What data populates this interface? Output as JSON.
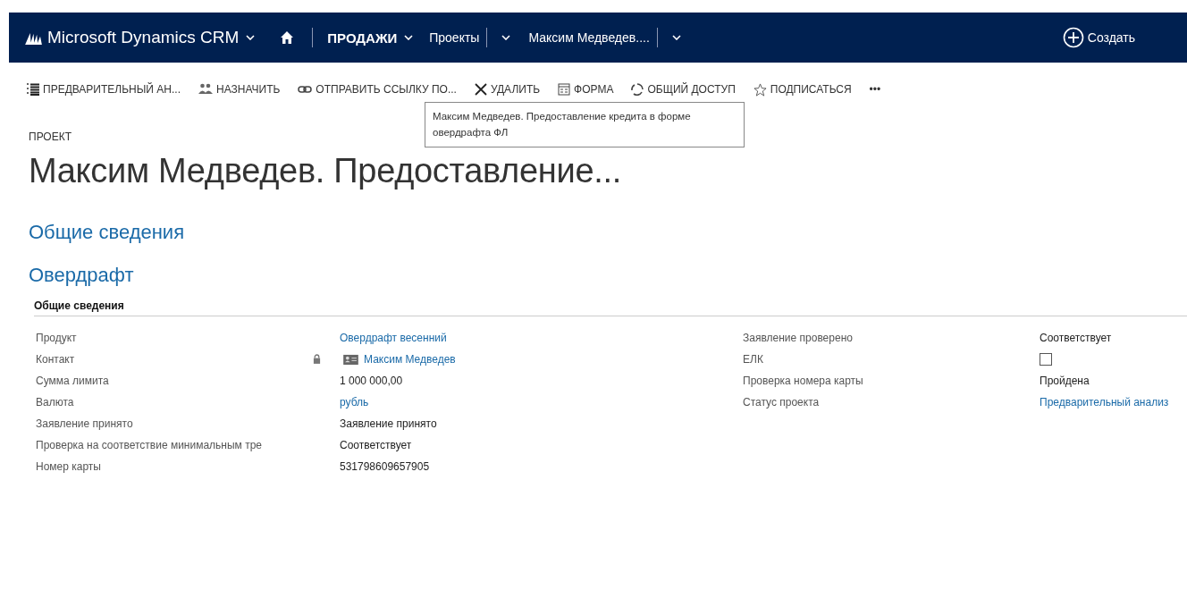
{
  "navbar": {
    "brand": "Microsoft Dynamics CRM",
    "area": "ПРОДАЖИ",
    "entity": "Проекты",
    "record": "Максим Медведев....",
    "create": "Создать"
  },
  "commands": [
    {
      "kind": "list",
      "label": "ПРЕДВАРИТЕЛЬНЫЙ АН..."
    },
    {
      "kind": "people",
      "label": "НАЗНАЧИТЬ"
    },
    {
      "kind": "link",
      "label": "ОТПРАВИТЬ ССЫЛКУ ПО..."
    },
    {
      "kind": "delete",
      "label": "УДАЛИТЬ"
    },
    {
      "kind": "form",
      "label": "ФОРМА"
    },
    {
      "kind": "share",
      "label": "ОБЩИЙ ДОСТУП"
    },
    {
      "kind": "star",
      "label": "ПОДПИСАТЬСЯ"
    },
    {
      "kind": "more",
      "label": "•••"
    }
  ],
  "tooltip": "Максим Медведев. Предоставление кредита в форме овердрафта ФЛ",
  "entity_label": "ПРОЕКТ",
  "title": "Максим Медведев. Предоставление...",
  "tabs": [
    "Общие сведения",
    "Овердрафт"
  ],
  "section": {
    "title": "Общие сведения",
    "left_fields": [
      {
        "label": "Продукт",
        "kind": "link",
        "value": "Овердрафт весенний",
        "locked": false
      },
      {
        "label": "Контакт",
        "kind": "contact",
        "value": "Максим Медведев",
        "locked": true
      },
      {
        "label": "Сумма лимита",
        "kind": "text",
        "value": "1 000 000,00",
        "locked": false
      },
      {
        "label": "Валюта",
        "kind": "link",
        "value": "рубль",
        "locked": false
      },
      {
        "label": "Заявление принято",
        "kind": "text",
        "value": "Заявление принято",
        "locked": false
      },
      {
        "label": "Проверка на соответствие минимальным тре",
        "kind": "text",
        "value": "Соответствует",
        "locked": false
      },
      {
        "label": "Номер карты",
        "kind": "text",
        "value": "531798609657905",
        "locked": false
      }
    ],
    "right_fields": [
      {
        "label": "Заявление проверено",
        "kind": "text",
        "value": "Соответствует"
      },
      {
        "label": "ЕЛК",
        "kind": "checkbox",
        "checked": false
      },
      {
        "label": "Проверка номера карты",
        "kind": "text",
        "value": "Пройдена"
      },
      {
        "label": "Статус проекта",
        "kind": "link",
        "value": "Предварительный анализ"
      }
    ]
  }
}
